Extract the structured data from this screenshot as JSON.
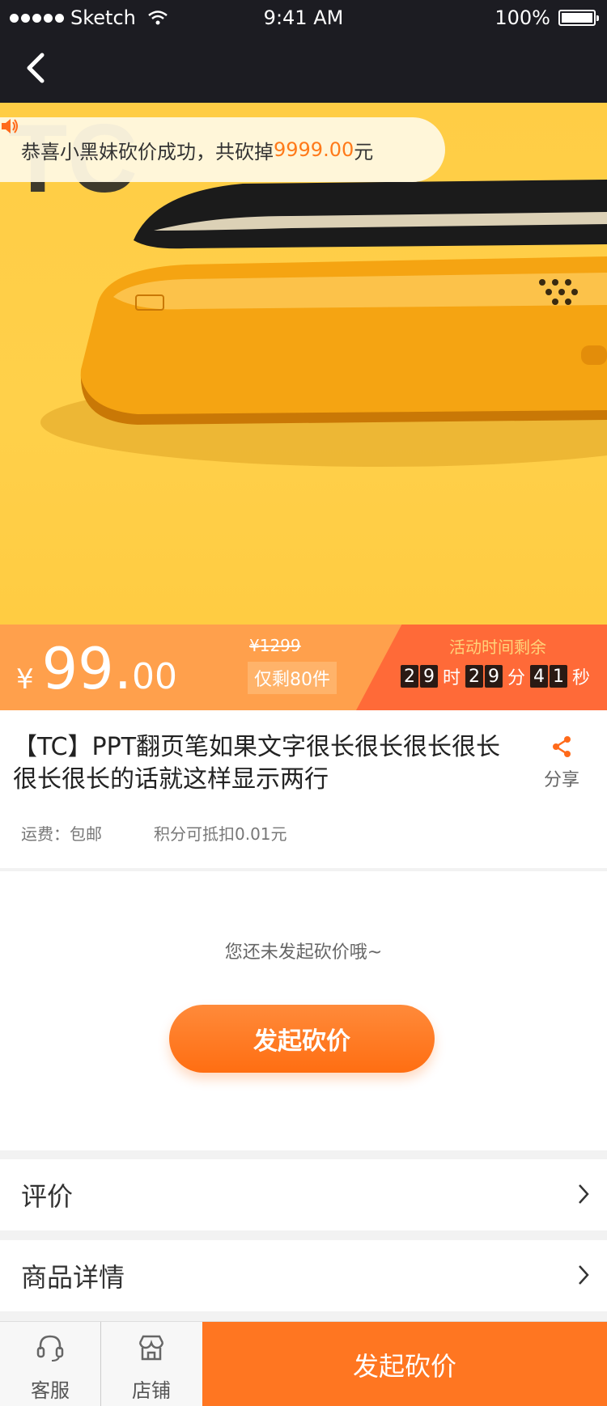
{
  "status": {
    "carrier": "Sketch",
    "time": "9:41 AM",
    "battery": "100%"
  },
  "notice": {
    "prefix": "恭喜小黑妹砍价成功，共砍掉 ",
    "amount": "9999.00",
    "suffix": "元"
  },
  "price": {
    "currency": "¥",
    "integer": "99",
    "dot": ".",
    "decimal": "00",
    "original": "¥1299",
    "stock": "仅剩80件"
  },
  "timer": {
    "title": "活动时间剩余",
    "h1": "2",
    "h2": "9",
    "h_unit": "时",
    "m1": "2",
    "m2": "9",
    "m_unit": "分",
    "s1": "4",
    "s2": "1",
    "s_unit": "秒"
  },
  "product": {
    "title": "【TC】PPT翻页笔如果文字很长很长很长很长很长很长的话就这样显示两行",
    "share_label": "分享",
    "shipping": "运费：包邮",
    "points": "积分可抵扣0.01元"
  },
  "bargain": {
    "tip": "您还未发起砍价哦~",
    "button": "发起砍价"
  },
  "rows": {
    "reviews": "评价",
    "details": "商品详情"
  },
  "bottom": {
    "service": "客服",
    "shop": "店铺",
    "action": "发起砍价"
  },
  "colors": {
    "accent": "#ff7621",
    "dark": "#1c1c22",
    "hero": "#ffcd45"
  }
}
